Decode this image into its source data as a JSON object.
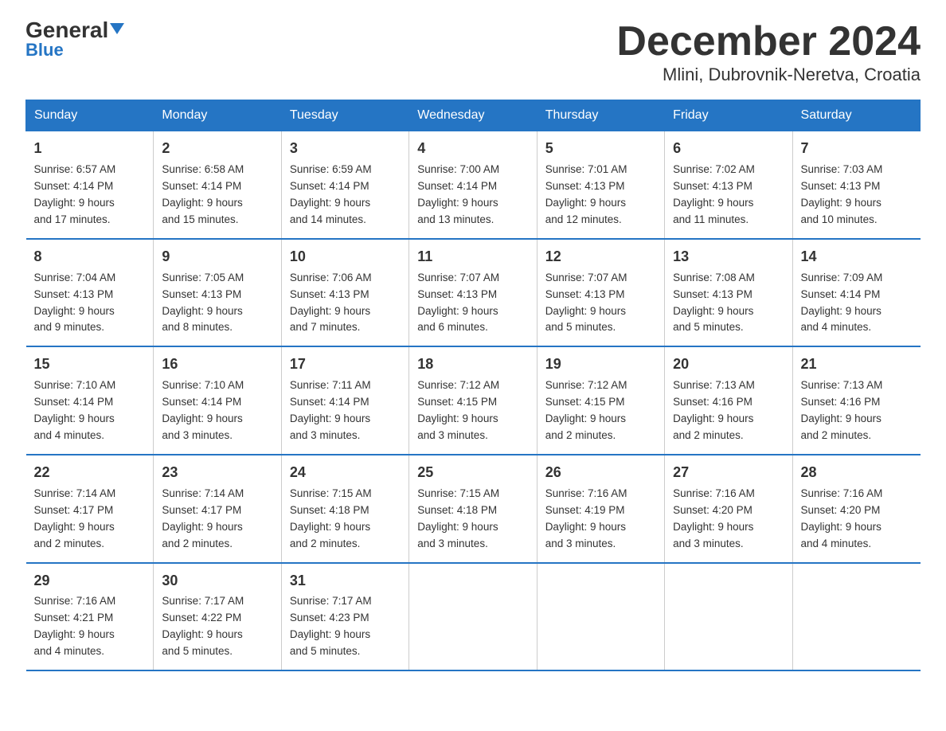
{
  "header": {
    "logo_general": "General",
    "logo_blue": "Blue",
    "month_title": "December 2024",
    "location": "Mlini, Dubrovnik-Neretva, Croatia"
  },
  "days_of_week": [
    "Sunday",
    "Monday",
    "Tuesday",
    "Wednesday",
    "Thursday",
    "Friday",
    "Saturday"
  ],
  "weeks": [
    [
      {
        "num": "1",
        "sunrise": "6:57 AM",
        "sunset": "4:14 PM",
        "daylight": "9 hours and 17 minutes."
      },
      {
        "num": "2",
        "sunrise": "6:58 AM",
        "sunset": "4:14 PM",
        "daylight": "9 hours and 15 minutes."
      },
      {
        "num": "3",
        "sunrise": "6:59 AM",
        "sunset": "4:14 PM",
        "daylight": "9 hours and 14 minutes."
      },
      {
        "num": "4",
        "sunrise": "7:00 AM",
        "sunset": "4:14 PM",
        "daylight": "9 hours and 13 minutes."
      },
      {
        "num": "5",
        "sunrise": "7:01 AM",
        "sunset": "4:13 PM",
        "daylight": "9 hours and 12 minutes."
      },
      {
        "num": "6",
        "sunrise": "7:02 AM",
        "sunset": "4:13 PM",
        "daylight": "9 hours and 11 minutes."
      },
      {
        "num": "7",
        "sunrise": "7:03 AM",
        "sunset": "4:13 PM",
        "daylight": "9 hours and 10 minutes."
      }
    ],
    [
      {
        "num": "8",
        "sunrise": "7:04 AM",
        "sunset": "4:13 PM",
        "daylight": "9 hours and 9 minutes."
      },
      {
        "num": "9",
        "sunrise": "7:05 AM",
        "sunset": "4:13 PM",
        "daylight": "9 hours and 8 minutes."
      },
      {
        "num": "10",
        "sunrise": "7:06 AM",
        "sunset": "4:13 PM",
        "daylight": "9 hours and 7 minutes."
      },
      {
        "num": "11",
        "sunrise": "7:07 AM",
        "sunset": "4:13 PM",
        "daylight": "9 hours and 6 minutes."
      },
      {
        "num": "12",
        "sunrise": "7:07 AM",
        "sunset": "4:13 PM",
        "daylight": "9 hours and 5 minutes."
      },
      {
        "num": "13",
        "sunrise": "7:08 AM",
        "sunset": "4:13 PM",
        "daylight": "9 hours and 5 minutes."
      },
      {
        "num": "14",
        "sunrise": "7:09 AM",
        "sunset": "4:14 PM",
        "daylight": "9 hours and 4 minutes."
      }
    ],
    [
      {
        "num": "15",
        "sunrise": "7:10 AM",
        "sunset": "4:14 PM",
        "daylight": "9 hours and 4 minutes."
      },
      {
        "num": "16",
        "sunrise": "7:10 AM",
        "sunset": "4:14 PM",
        "daylight": "9 hours and 3 minutes."
      },
      {
        "num": "17",
        "sunrise": "7:11 AM",
        "sunset": "4:14 PM",
        "daylight": "9 hours and 3 minutes."
      },
      {
        "num": "18",
        "sunrise": "7:12 AM",
        "sunset": "4:15 PM",
        "daylight": "9 hours and 3 minutes."
      },
      {
        "num": "19",
        "sunrise": "7:12 AM",
        "sunset": "4:15 PM",
        "daylight": "9 hours and 2 minutes."
      },
      {
        "num": "20",
        "sunrise": "7:13 AM",
        "sunset": "4:16 PM",
        "daylight": "9 hours and 2 minutes."
      },
      {
        "num": "21",
        "sunrise": "7:13 AM",
        "sunset": "4:16 PM",
        "daylight": "9 hours and 2 minutes."
      }
    ],
    [
      {
        "num": "22",
        "sunrise": "7:14 AM",
        "sunset": "4:17 PM",
        "daylight": "9 hours and 2 minutes."
      },
      {
        "num": "23",
        "sunrise": "7:14 AM",
        "sunset": "4:17 PM",
        "daylight": "9 hours and 2 minutes."
      },
      {
        "num": "24",
        "sunrise": "7:15 AM",
        "sunset": "4:18 PM",
        "daylight": "9 hours and 2 minutes."
      },
      {
        "num": "25",
        "sunrise": "7:15 AM",
        "sunset": "4:18 PM",
        "daylight": "9 hours and 3 minutes."
      },
      {
        "num": "26",
        "sunrise": "7:16 AM",
        "sunset": "4:19 PM",
        "daylight": "9 hours and 3 minutes."
      },
      {
        "num": "27",
        "sunrise": "7:16 AM",
        "sunset": "4:20 PM",
        "daylight": "9 hours and 3 minutes."
      },
      {
        "num": "28",
        "sunrise": "7:16 AM",
        "sunset": "4:20 PM",
        "daylight": "9 hours and 4 minutes."
      }
    ],
    [
      {
        "num": "29",
        "sunrise": "7:16 AM",
        "sunset": "4:21 PM",
        "daylight": "9 hours and 4 minutes."
      },
      {
        "num": "30",
        "sunrise": "7:17 AM",
        "sunset": "4:22 PM",
        "daylight": "9 hours and 5 minutes."
      },
      {
        "num": "31",
        "sunrise": "7:17 AM",
        "sunset": "4:23 PM",
        "daylight": "9 hours and 5 minutes."
      },
      null,
      null,
      null,
      null
    ]
  ],
  "labels": {
    "sunrise": "Sunrise:",
    "sunset": "Sunset:",
    "daylight": "Daylight:"
  }
}
